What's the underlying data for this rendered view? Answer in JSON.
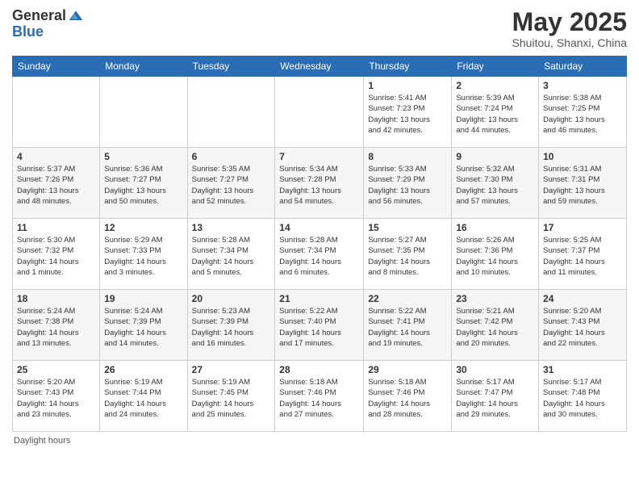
{
  "header": {
    "logo_general": "General",
    "logo_blue": "Blue",
    "title": "May 2025",
    "location": "Shuitou, Shanxi, China"
  },
  "weekdays": [
    "Sunday",
    "Monday",
    "Tuesday",
    "Wednesday",
    "Thursday",
    "Friday",
    "Saturday"
  ],
  "weeks": [
    [
      {
        "day": "",
        "info": ""
      },
      {
        "day": "",
        "info": ""
      },
      {
        "day": "",
        "info": ""
      },
      {
        "day": "",
        "info": ""
      },
      {
        "day": "1",
        "info": "Sunrise: 5:41 AM\nSunset: 7:23 PM\nDaylight: 13 hours\nand 42 minutes."
      },
      {
        "day": "2",
        "info": "Sunrise: 5:39 AM\nSunset: 7:24 PM\nDaylight: 13 hours\nand 44 minutes."
      },
      {
        "day": "3",
        "info": "Sunrise: 5:38 AM\nSunset: 7:25 PM\nDaylight: 13 hours\nand 46 minutes."
      }
    ],
    [
      {
        "day": "4",
        "info": "Sunrise: 5:37 AM\nSunset: 7:26 PM\nDaylight: 13 hours\nand 48 minutes."
      },
      {
        "day": "5",
        "info": "Sunrise: 5:36 AM\nSunset: 7:27 PM\nDaylight: 13 hours\nand 50 minutes."
      },
      {
        "day": "6",
        "info": "Sunrise: 5:35 AM\nSunset: 7:27 PM\nDaylight: 13 hours\nand 52 minutes."
      },
      {
        "day": "7",
        "info": "Sunrise: 5:34 AM\nSunset: 7:28 PM\nDaylight: 13 hours\nand 54 minutes."
      },
      {
        "day": "8",
        "info": "Sunrise: 5:33 AM\nSunset: 7:29 PM\nDaylight: 13 hours\nand 56 minutes."
      },
      {
        "day": "9",
        "info": "Sunrise: 5:32 AM\nSunset: 7:30 PM\nDaylight: 13 hours\nand 57 minutes."
      },
      {
        "day": "10",
        "info": "Sunrise: 5:31 AM\nSunset: 7:31 PM\nDaylight: 13 hours\nand 59 minutes."
      }
    ],
    [
      {
        "day": "11",
        "info": "Sunrise: 5:30 AM\nSunset: 7:32 PM\nDaylight: 14 hours\nand 1 minute."
      },
      {
        "day": "12",
        "info": "Sunrise: 5:29 AM\nSunset: 7:33 PM\nDaylight: 14 hours\nand 3 minutes."
      },
      {
        "day": "13",
        "info": "Sunrise: 5:28 AM\nSunset: 7:34 PM\nDaylight: 14 hours\nand 5 minutes."
      },
      {
        "day": "14",
        "info": "Sunrise: 5:28 AM\nSunset: 7:34 PM\nDaylight: 14 hours\nand 6 minutes."
      },
      {
        "day": "15",
        "info": "Sunrise: 5:27 AM\nSunset: 7:35 PM\nDaylight: 14 hours\nand 8 minutes."
      },
      {
        "day": "16",
        "info": "Sunrise: 5:26 AM\nSunset: 7:36 PM\nDaylight: 14 hours\nand 10 minutes."
      },
      {
        "day": "17",
        "info": "Sunrise: 5:25 AM\nSunset: 7:37 PM\nDaylight: 14 hours\nand 11 minutes."
      }
    ],
    [
      {
        "day": "18",
        "info": "Sunrise: 5:24 AM\nSunset: 7:38 PM\nDaylight: 14 hours\nand 13 minutes."
      },
      {
        "day": "19",
        "info": "Sunrise: 5:24 AM\nSunset: 7:39 PM\nDaylight: 14 hours\nand 14 minutes."
      },
      {
        "day": "20",
        "info": "Sunrise: 5:23 AM\nSunset: 7:39 PM\nDaylight: 14 hours\nand 16 minutes."
      },
      {
        "day": "21",
        "info": "Sunrise: 5:22 AM\nSunset: 7:40 PM\nDaylight: 14 hours\nand 17 minutes."
      },
      {
        "day": "22",
        "info": "Sunrise: 5:22 AM\nSunset: 7:41 PM\nDaylight: 14 hours\nand 19 minutes."
      },
      {
        "day": "23",
        "info": "Sunrise: 5:21 AM\nSunset: 7:42 PM\nDaylight: 14 hours\nand 20 minutes."
      },
      {
        "day": "24",
        "info": "Sunrise: 5:20 AM\nSunset: 7:43 PM\nDaylight: 14 hours\nand 22 minutes."
      }
    ],
    [
      {
        "day": "25",
        "info": "Sunrise: 5:20 AM\nSunset: 7:43 PM\nDaylight: 14 hours\nand 23 minutes."
      },
      {
        "day": "26",
        "info": "Sunrise: 5:19 AM\nSunset: 7:44 PM\nDaylight: 14 hours\nand 24 minutes."
      },
      {
        "day": "27",
        "info": "Sunrise: 5:19 AM\nSunset: 7:45 PM\nDaylight: 14 hours\nand 25 minutes."
      },
      {
        "day": "28",
        "info": "Sunrise: 5:18 AM\nSunset: 7:46 PM\nDaylight: 14 hours\nand 27 minutes."
      },
      {
        "day": "29",
        "info": "Sunrise: 5:18 AM\nSunset: 7:46 PM\nDaylight: 14 hours\nand 28 minutes."
      },
      {
        "day": "30",
        "info": "Sunrise: 5:17 AM\nSunset: 7:47 PM\nDaylight: 14 hours\nand 29 minutes."
      },
      {
        "day": "31",
        "info": "Sunrise: 5:17 AM\nSunset: 7:48 PM\nDaylight: 14 hours\nand 30 minutes."
      }
    ]
  ],
  "footer": {
    "daylight_label": "Daylight hours"
  }
}
